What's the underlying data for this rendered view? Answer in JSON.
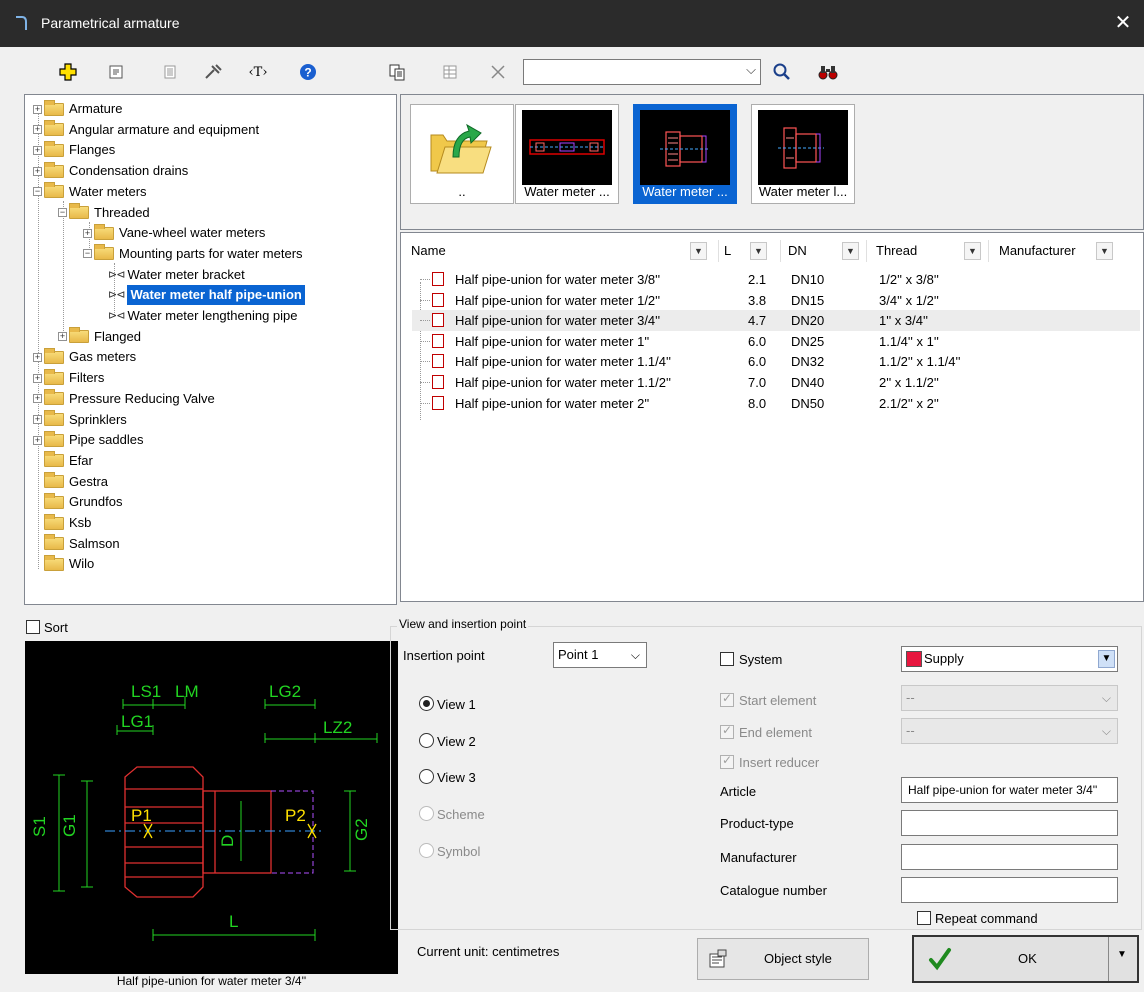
{
  "window": {
    "title": "Parametrical armature",
    "close_glyph": "✕"
  },
  "toolbar": {
    "icons": [
      "add-icon",
      "properties-icon",
      "document-icon",
      "tools-icon",
      "text-icon",
      "help-icon",
      "copy-icon",
      "table-icon",
      "delete-icon",
      "search-icon",
      "binoculars-icon"
    ],
    "search_value": ""
  },
  "tree": [
    {
      "label": "Armature",
      "expander": "+"
    },
    {
      "label": "Angular armature and equipment",
      "expander": "+"
    },
    {
      "label": "Flanges",
      "expander": "+"
    },
    {
      "label": "Condensation drains",
      "expander": "+"
    },
    {
      "label": "Water meters",
      "expander": "−"
    },
    {
      "label": "Threaded",
      "expander": "−"
    },
    {
      "label": "Vane-wheel water meters",
      "expander": "+"
    },
    {
      "label": "Mounting parts for water meters",
      "expander": "−"
    },
    {
      "label": "Water meter bracket",
      "expander": ""
    },
    {
      "label": "Water meter half pipe-union",
      "expander": "",
      "selected": true
    },
    {
      "label": "Water meter lengthening pipe",
      "expander": ""
    },
    {
      "label": "Flanged",
      "expander": "+"
    },
    {
      "label": "Gas meters",
      "expander": "+"
    },
    {
      "label": "Filters",
      "expander": "+"
    },
    {
      "label": "Pressure Reducing Valve",
      "expander": "+"
    },
    {
      "label": "Sprinklers",
      "expander": "+"
    },
    {
      "label": "Pipe saddles",
      "expander": "+"
    },
    {
      "label": "Efar",
      "expander": ""
    },
    {
      "label": "Gestra",
      "expander": ""
    },
    {
      "label": "Grundfos",
      "expander": ""
    },
    {
      "label": "Ksb",
      "expander": ""
    },
    {
      "label": "Salmson",
      "expander": ""
    },
    {
      "label": "Wilo",
      "expander": ""
    }
  ],
  "thumbnails": [
    {
      "label": ".."
    },
    {
      "label": "Water meter ..."
    },
    {
      "label": "Water meter ...",
      "active": true
    },
    {
      "label": "Water meter l..."
    }
  ],
  "table": {
    "headers": [
      "Name",
      "L",
      "DN",
      "Thread",
      "Manufacturer"
    ],
    "rows": [
      {
        "name": "Half pipe-union for water meter 3/8''",
        "l": "2.1",
        "dn": "DN10",
        "thread": "1/2'' x 3/8''"
      },
      {
        "name": "Half pipe-union for water meter 1/2''",
        "l": "3.8",
        "dn": "DN15",
        "thread": "3/4'' x 1/2''"
      },
      {
        "name": "Half pipe-union for water meter 3/4''",
        "l": "4.7",
        "dn": "DN20",
        "thread": "1'' x 3/4''"
      },
      {
        "name": "Half pipe-union for water meter 1''",
        "l": "6.0",
        "dn": "DN25",
        "thread": "1.1/4'' x 1''"
      },
      {
        "name": "Half pipe-union for water meter 1.1/4''",
        "l": "6.0",
        "dn": "DN32",
        "thread": "1.1/2'' x 1.1/4''"
      },
      {
        "name": "Half pipe-union for water meter 1.1/2''",
        "l": "7.0",
        "dn": "DN40",
        "thread": "2'' x 1.1/2''"
      },
      {
        "name": "Half pipe-union for water meter 2''",
        "l": "8.0",
        "dn": "DN50",
        "thread": "2.1/2'' x 2''"
      }
    ]
  },
  "sort": {
    "label": "Sort",
    "checked": false
  },
  "preview": {
    "caption": "Half pipe-union for water meter 3/4''",
    "dim_labels": [
      "LS1",
      "LM",
      "LG2",
      "LG1",
      "LZ2",
      "S1",
      "G1",
      "P1",
      "D",
      "P2",
      "G2",
      "L"
    ]
  },
  "view_group": {
    "legend": "View and insertion point",
    "insertion_point_label": "Insertion point",
    "insertion_point_value": "Point 1",
    "views": [
      {
        "label": "View 1",
        "checked": true,
        "enabled": true
      },
      {
        "label": "View 2",
        "checked": false,
        "enabled": true
      },
      {
        "label": "View 3",
        "checked": false,
        "enabled": true
      },
      {
        "label": "Scheme",
        "checked": false,
        "enabled": false
      },
      {
        "label": "Symbol",
        "checked": false,
        "enabled": false
      }
    ],
    "system_label": "System",
    "system_value": "Supply",
    "system_color": "#e8173f",
    "start_element_label": "Start element",
    "start_element_value": "--",
    "end_element_label": "End element",
    "end_element_value": "--",
    "insert_reducer_label": "Insert reducer",
    "article_label": "Article",
    "article_value": "Half pipe-union for water meter 3/4''",
    "product_type_label": "Product-type",
    "product_type_value": "",
    "manufacturer_label": "Manufacturer",
    "manufacturer_value": "",
    "catalogue_label": "Catalogue number",
    "catalogue_value": "",
    "repeat_label": "Repeat command"
  },
  "footer": {
    "current_unit": "Current unit: centimetres",
    "object_style_label": "Object style",
    "ok_label": "OK"
  }
}
